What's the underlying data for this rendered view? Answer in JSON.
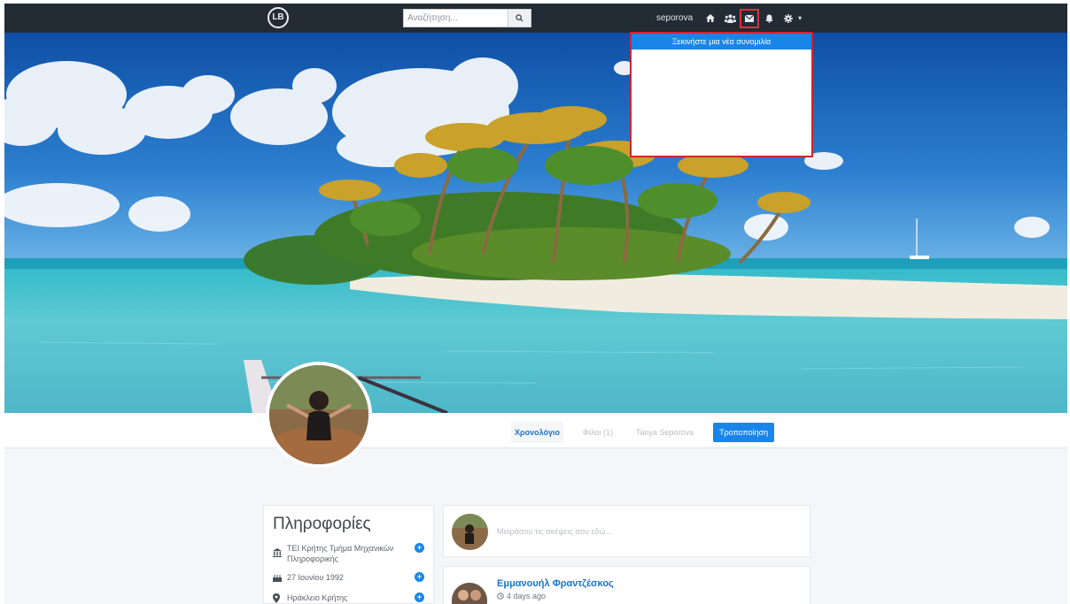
{
  "navbar": {
    "logo_text": "LB",
    "search_placeholder": "Αναζήτηση...",
    "username": "seporova",
    "icons": [
      "home-icon",
      "friends-icon",
      "messages-icon",
      "bell-icon",
      "gear-icon"
    ]
  },
  "messages_dropdown": {
    "header": "Ξεκινήστε μια νέα συνομιλία"
  },
  "profile_tabs": {
    "timeline": "Χρονολόγιο",
    "friends": "Φίλοι (1)",
    "name": "Tanya Seporova",
    "edit": "Τροποποίηση"
  },
  "info": {
    "title": "Πληροφορίες",
    "items": [
      {
        "icon": "institution-icon",
        "text": "ΤΕΙ Κρήτης Τμήμα Μηχανικών Πληροφορικής"
      },
      {
        "icon": "birthday-cake-icon",
        "text": "27 Ιουνίου 1992"
      },
      {
        "icon": "map-marker-icon",
        "text": "Ηράκλειο Κρήτης"
      }
    ]
  },
  "post_box": {
    "placeholder": "Μοιράσου τις σκέψεις σου εδώ..."
  },
  "feed": {
    "author": "Εμμανουήλ Φραντζέσκος",
    "time": "4 days ago"
  },
  "colors": {
    "navbar": "#232b35",
    "accent": "#1a85e8",
    "highlight": "#d3232f"
  }
}
